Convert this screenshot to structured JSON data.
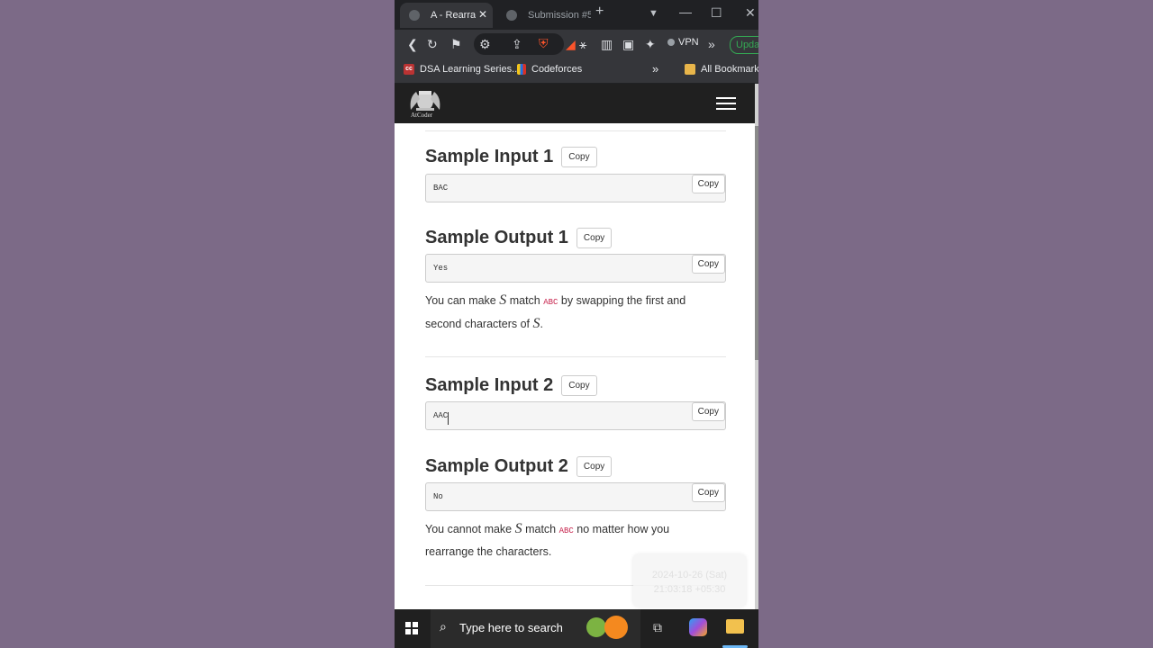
{
  "browser": {
    "tabs": [
      {
        "label": "A - Rearra",
        "active": true
      },
      {
        "label": "Submission #5",
        "active": false
      }
    ],
    "vpn_label": "VPN",
    "update_label": "Updat",
    "bookmarks": [
      {
        "label": "DSA Learning Series...",
        "icon": "cc-icon"
      },
      {
        "label": "Codeforces",
        "icon": "codeforces-icon"
      }
    ],
    "all_bookmarks_label": "All Bookmarks"
  },
  "site": {
    "logo_text": "AtCoder"
  },
  "samples": [
    {
      "input_title": "Sample Input 1",
      "input": "BAC",
      "output_title": "Sample Output 1",
      "output": "Yes"
    },
    {
      "input_title": "Sample Input 2",
      "input": "AAC",
      "output_title": "Sample Output 2",
      "output": "No"
    }
  ],
  "copy_label": "Copy",
  "explanations": {
    "e1": {
      "a": "You can make ",
      "var1": "S",
      "b": " match ",
      "code": "ABC",
      "c": " by swapping the first and second characters of ",
      "var2": "S",
      "d": "."
    },
    "e2": {
      "a": "You cannot make ",
      "var1": "S",
      "b": " match ",
      "code": "ABC",
      "c": " no matter how you rearrange the characters."
    }
  },
  "overlay": {
    "line1": "2024-10-26 (Sat)",
    "line2": "21:03:18 +05:30"
  },
  "taskbar": {
    "search_placeholder": "Type here to search"
  },
  "colors": {
    "desktop": "#7c6a87",
    "browser_dark": "#202124",
    "update_green": "#34a853",
    "code_pink": "#c7254e"
  }
}
